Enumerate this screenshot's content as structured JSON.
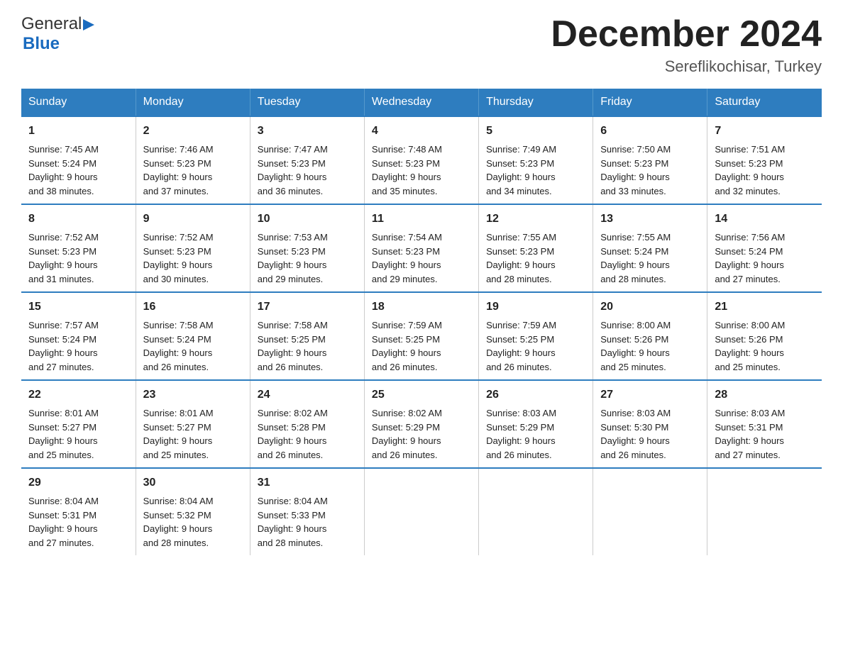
{
  "logo": {
    "text_general": "General",
    "text_blue": "Blue"
  },
  "header": {
    "month_year": "December 2024",
    "location": "Sereflikochisar, Turkey"
  },
  "days_of_week": [
    "Sunday",
    "Monday",
    "Tuesday",
    "Wednesday",
    "Thursday",
    "Friday",
    "Saturday"
  ],
  "weeks": [
    [
      {
        "day": "1",
        "sunrise": "7:45 AM",
        "sunset": "5:24 PM",
        "daylight": "9 hours and 38 minutes."
      },
      {
        "day": "2",
        "sunrise": "7:46 AM",
        "sunset": "5:23 PM",
        "daylight": "9 hours and 37 minutes."
      },
      {
        "day": "3",
        "sunrise": "7:47 AM",
        "sunset": "5:23 PM",
        "daylight": "9 hours and 36 minutes."
      },
      {
        "day": "4",
        "sunrise": "7:48 AM",
        "sunset": "5:23 PM",
        "daylight": "9 hours and 35 minutes."
      },
      {
        "day": "5",
        "sunrise": "7:49 AM",
        "sunset": "5:23 PM",
        "daylight": "9 hours and 34 minutes."
      },
      {
        "day": "6",
        "sunrise": "7:50 AM",
        "sunset": "5:23 PM",
        "daylight": "9 hours and 33 minutes."
      },
      {
        "day": "7",
        "sunrise": "7:51 AM",
        "sunset": "5:23 PM",
        "daylight": "9 hours and 32 minutes."
      }
    ],
    [
      {
        "day": "8",
        "sunrise": "7:52 AM",
        "sunset": "5:23 PM",
        "daylight": "9 hours and 31 minutes."
      },
      {
        "day": "9",
        "sunrise": "7:52 AM",
        "sunset": "5:23 PM",
        "daylight": "9 hours and 30 minutes."
      },
      {
        "day": "10",
        "sunrise": "7:53 AM",
        "sunset": "5:23 PM",
        "daylight": "9 hours and 29 minutes."
      },
      {
        "day": "11",
        "sunrise": "7:54 AM",
        "sunset": "5:23 PM",
        "daylight": "9 hours and 29 minutes."
      },
      {
        "day": "12",
        "sunrise": "7:55 AM",
        "sunset": "5:23 PM",
        "daylight": "9 hours and 28 minutes."
      },
      {
        "day": "13",
        "sunrise": "7:55 AM",
        "sunset": "5:24 PM",
        "daylight": "9 hours and 28 minutes."
      },
      {
        "day": "14",
        "sunrise": "7:56 AM",
        "sunset": "5:24 PM",
        "daylight": "9 hours and 27 minutes."
      }
    ],
    [
      {
        "day": "15",
        "sunrise": "7:57 AM",
        "sunset": "5:24 PM",
        "daylight": "9 hours and 27 minutes."
      },
      {
        "day": "16",
        "sunrise": "7:58 AM",
        "sunset": "5:24 PM",
        "daylight": "9 hours and 26 minutes."
      },
      {
        "day": "17",
        "sunrise": "7:58 AM",
        "sunset": "5:25 PM",
        "daylight": "9 hours and 26 minutes."
      },
      {
        "day": "18",
        "sunrise": "7:59 AM",
        "sunset": "5:25 PM",
        "daylight": "9 hours and 26 minutes."
      },
      {
        "day": "19",
        "sunrise": "7:59 AM",
        "sunset": "5:25 PM",
        "daylight": "9 hours and 26 minutes."
      },
      {
        "day": "20",
        "sunrise": "8:00 AM",
        "sunset": "5:26 PM",
        "daylight": "9 hours and 25 minutes."
      },
      {
        "day": "21",
        "sunrise": "8:00 AM",
        "sunset": "5:26 PM",
        "daylight": "9 hours and 25 minutes."
      }
    ],
    [
      {
        "day": "22",
        "sunrise": "8:01 AM",
        "sunset": "5:27 PM",
        "daylight": "9 hours and 25 minutes."
      },
      {
        "day": "23",
        "sunrise": "8:01 AM",
        "sunset": "5:27 PM",
        "daylight": "9 hours and 25 minutes."
      },
      {
        "day": "24",
        "sunrise": "8:02 AM",
        "sunset": "5:28 PM",
        "daylight": "9 hours and 26 minutes."
      },
      {
        "day": "25",
        "sunrise": "8:02 AM",
        "sunset": "5:29 PM",
        "daylight": "9 hours and 26 minutes."
      },
      {
        "day": "26",
        "sunrise": "8:03 AM",
        "sunset": "5:29 PM",
        "daylight": "9 hours and 26 minutes."
      },
      {
        "day": "27",
        "sunrise": "8:03 AM",
        "sunset": "5:30 PM",
        "daylight": "9 hours and 26 minutes."
      },
      {
        "day": "28",
        "sunrise": "8:03 AM",
        "sunset": "5:31 PM",
        "daylight": "9 hours and 27 minutes."
      }
    ],
    [
      {
        "day": "29",
        "sunrise": "8:04 AM",
        "sunset": "5:31 PM",
        "daylight": "9 hours and 27 minutes."
      },
      {
        "day": "30",
        "sunrise": "8:04 AM",
        "sunset": "5:32 PM",
        "daylight": "9 hours and 28 minutes."
      },
      {
        "day": "31",
        "sunrise": "8:04 AM",
        "sunset": "5:33 PM",
        "daylight": "9 hours and 28 minutes."
      },
      null,
      null,
      null,
      null
    ]
  ],
  "labels": {
    "sunrise": "Sunrise:",
    "sunset": "Sunset:",
    "daylight": "Daylight:"
  }
}
